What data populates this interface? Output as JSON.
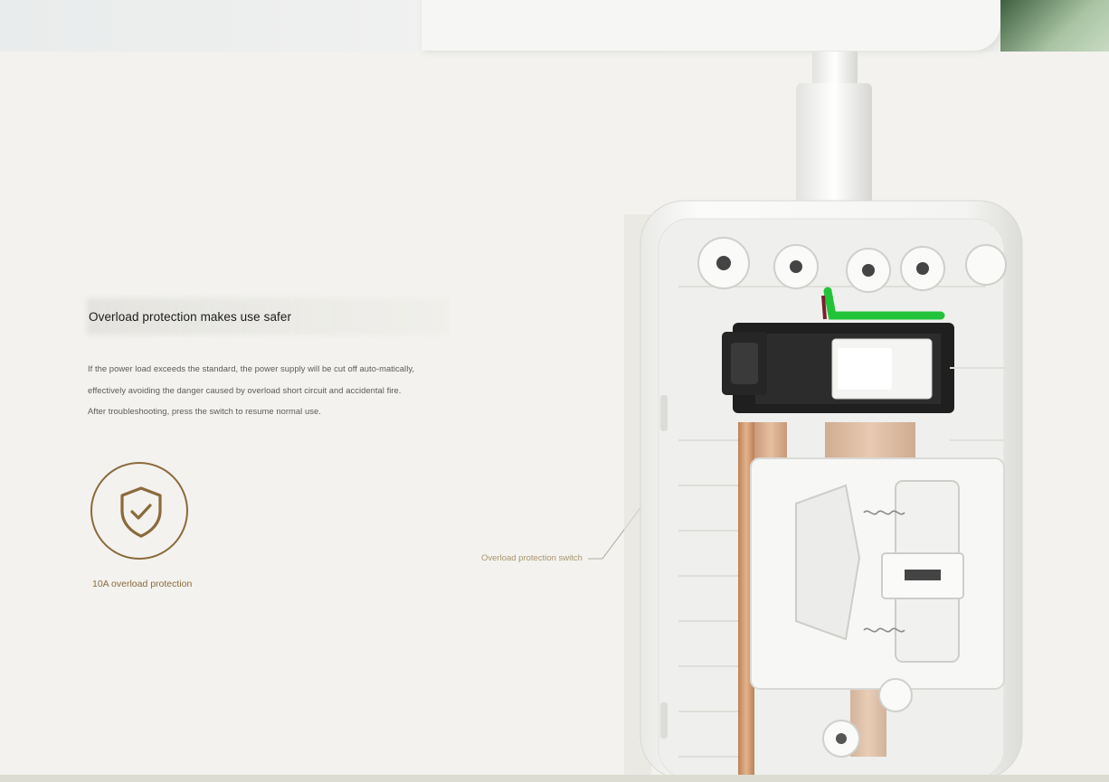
{
  "content": {
    "headline": "Overload protection makes use safer",
    "body": "If the power load exceeds the standard, the power supply will be cut off auto-matically, effectively avoiding the danger caused by overload short circuit and accidental fire. After troubleshooting, press the switch to resume normal use.",
    "feature_label": "10A overload protection",
    "callout_label": "Overload protection switch"
  },
  "icons": {
    "feature": "shield-check-icon"
  },
  "colors": {
    "accent": "#8a6a3c",
    "background": "#f3f2ee",
    "wire_green": "#22c33a",
    "copper": "#c98a5a"
  }
}
